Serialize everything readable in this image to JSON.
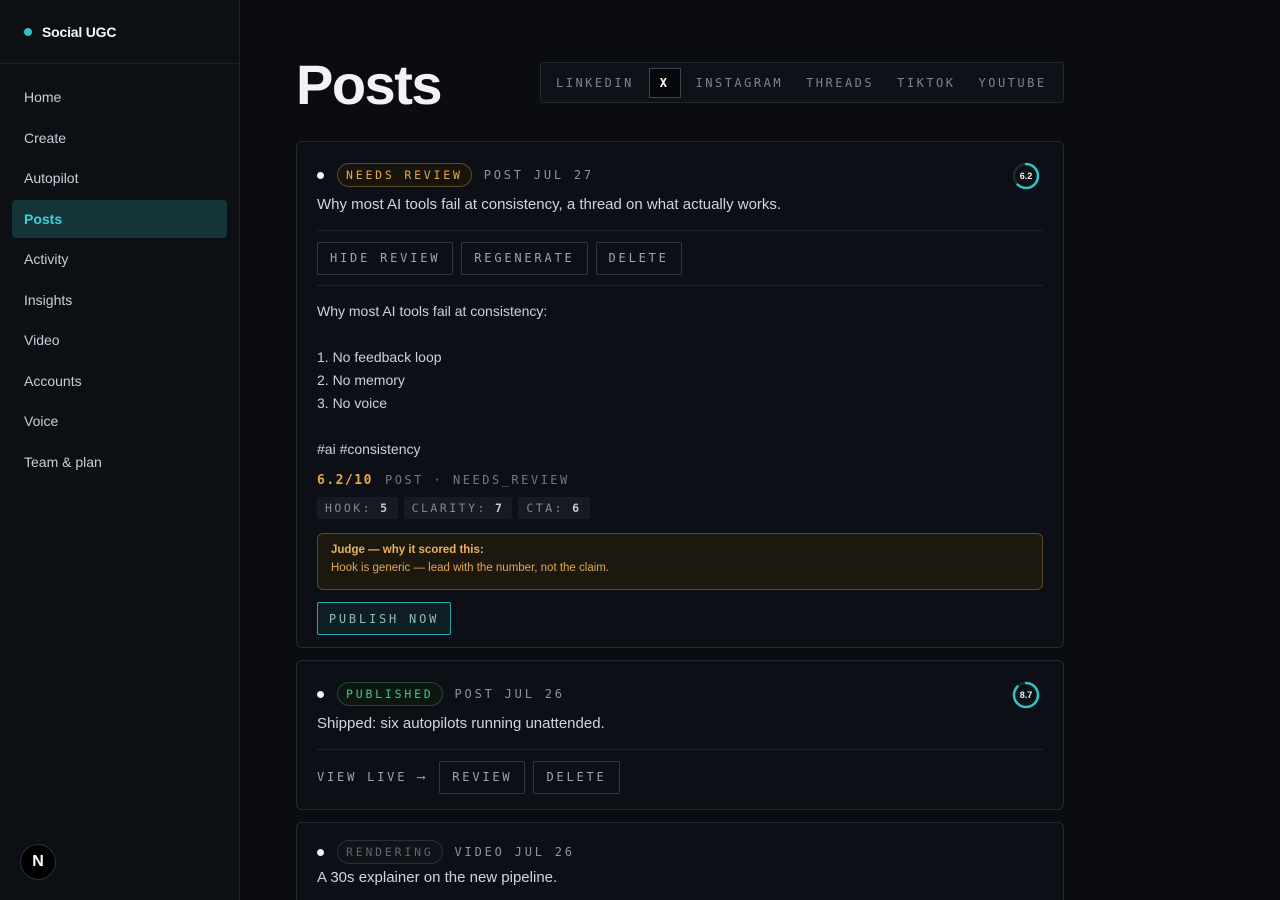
{
  "brand": {
    "name": "Social UGC"
  },
  "sidebar": {
    "items": [
      {
        "label": "Home"
      },
      {
        "label": "Create"
      },
      {
        "label": "Autopilot"
      },
      {
        "label": "Posts"
      },
      {
        "label": "Activity"
      },
      {
        "label": "Insights"
      },
      {
        "label": "Video"
      },
      {
        "label": "Accounts"
      },
      {
        "label": "Voice"
      },
      {
        "label": "Team & plan"
      }
    ],
    "active": "Posts",
    "avatar_letter": "N"
  },
  "page": {
    "title": "Posts"
  },
  "platform_tabs": {
    "items": [
      "LINKEDIN",
      "X",
      "INSTAGRAM",
      "THREADS",
      "TIKTOK",
      "YOUTUBE"
    ],
    "active": "X"
  },
  "posts": [
    {
      "status": "NEEDS REVIEW",
      "meta": "POST  JUL 27",
      "score_ring": "6.2",
      "score_fraction": 0.62,
      "title": "Why most AI tools fail at consistency, a thread on what actually works.",
      "actions": [
        "HIDE REVIEW",
        "REGENERATE",
        "DELETE"
      ],
      "body": {
        "l1": "Why most AI tools fail at consistency:",
        "l2": "1. No feedback loop",
        "l3": "2. No memory",
        "l4": "3. No voice",
        "l5": "#ai #consistency"
      },
      "score_text": "6.2/10",
      "score_meta": "POST · NEEDS_REVIEW",
      "chips": [
        {
          "label": "HOOK:",
          "value": "5"
        },
        {
          "label": "CLARITY:",
          "value": "7"
        },
        {
          "label": "CTA:",
          "value": "6"
        }
      ],
      "judge": {
        "title": "Judge — why it scored this:",
        "text": "Hook is generic — lead with the number, not the claim."
      },
      "publish_label": "PUBLISH NOW"
    },
    {
      "status": "PUBLISHED",
      "meta": "POST  JUL 26",
      "score_ring": "8.7",
      "score_fraction": 0.87,
      "title": "Shipped: six autopilots running unattended.",
      "view_live": "VIEW LIVE ⟶",
      "actions": [
        "REVIEW",
        "DELETE"
      ]
    },
    {
      "status": "RENDERING",
      "meta": "VIDEO  JUL 26",
      "title": "A 30s explainer on the new pipeline."
    }
  ],
  "colors": {
    "accent": "#2ec4c8",
    "review": "#e3a94a",
    "published": "#49c08a",
    "background": "#0a0c10"
  }
}
